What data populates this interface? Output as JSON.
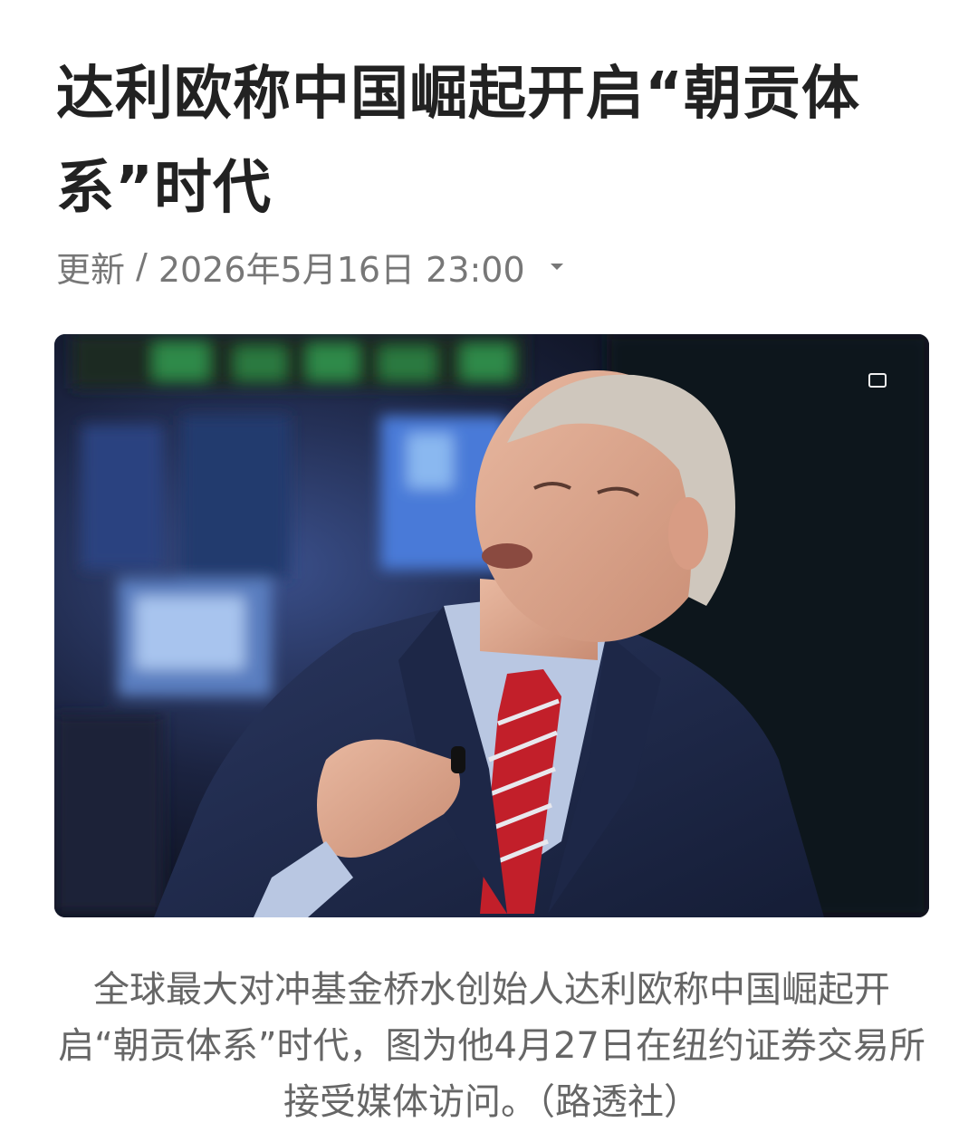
{
  "article": {
    "headline": "达利欧称中国崛起开启“朝贡体系”时代",
    "meta": {
      "update_label": "更新",
      "separator": "/",
      "datetime": "2026年5月16日 23:00",
      "expand_icon": "chevron-down-icon"
    },
    "photo": {
      "icon": "expand-photo-icon"
    },
    "caption": "全球最大对冲基金桥水创始人达利欧称中国崛起开启“朝贡体系”时代，图为他4月27日在纽约证券交易所接受媒体访问。（路透社）"
  },
  "colors": {
    "headline": "#222222",
    "meta": "#777777",
    "caption": "#666666",
    "photo_background": "#141a2a",
    "suit": "#1f2a4a",
    "tie": "#c21f2a"
  }
}
